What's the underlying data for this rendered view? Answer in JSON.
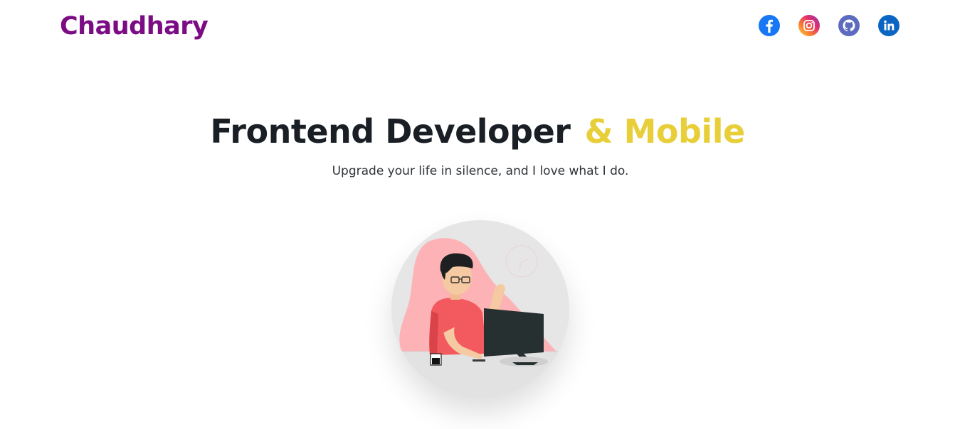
{
  "header": {
    "brand": "Chaudhary",
    "brand_color": "#7b0c84",
    "socials": [
      {
        "name": "facebook",
        "icon": "facebook-icon",
        "color": "#1877f2"
      },
      {
        "name": "instagram",
        "icon": "instagram-icon",
        "color": "#e1306c"
      },
      {
        "name": "github",
        "icon": "github-icon",
        "color": "#5c6bc0"
      },
      {
        "name": "linkedin",
        "icon": "linkedin-icon",
        "color": "#0a66c2"
      }
    ]
  },
  "hero": {
    "title_main": "Frontend Developer",
    "title_accent": "& Mobile",
    "accent_color": "#e8cf3a",
    "subtitle": "Upgrade your life in silence, and I love what I do.",
    "image_icon": "developer-at-computer-illustration"
  }
}
